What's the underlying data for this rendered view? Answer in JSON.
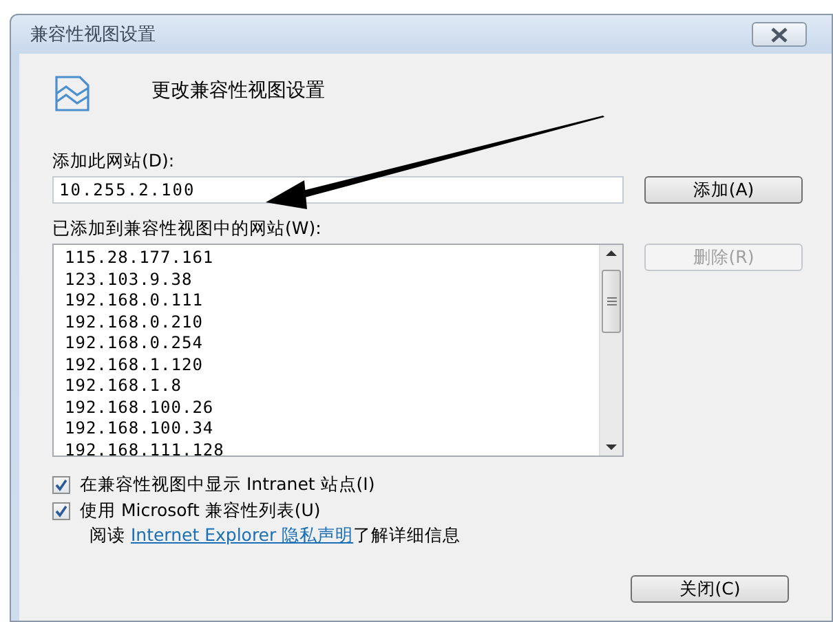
{
  "window": {
    "title": "兼容性视图设置"
  },
  "heading": "更改兼容性视图设置",
  "add_site": {
    "label": "添加此网站(D):",
    "value": "10.255.2.100",
    "button": {
      "label": "添加(A)",
      "disabled": false
    }
  },
  "site_list": {
    "label": "已添加到兼容性视图中的网站(W):",
    "items": [
      "115.28.177.161",
      "123.103.9.38",
      "192.168.0.111",
      "192.168.0.210",
      "192.168.0.254",
      "192.168.1.120",
      "192.168.1.8",
      "192.168.100.26",
      "192.168.100.34",
      "192.168.111.128"
    ],
    "remove_button": {
      "label": "删除(R)",
      "disabled": true
    }
  },
  "options": [
    {
      "label": "在兼容性视图中显示 Intranet 站点(I)",
      "checked": true
    },
    {
      "label": "使用 Microsoft 兼容性列表(U)",
      "checked": true
    }
  ],
  "privacy_note": {
    "before": "阅读 ",
    "link": "Internet Explorer 隐私声明",
    "after": "了解详细信息"
  },
  "close_button": "关闭(C)"
}
